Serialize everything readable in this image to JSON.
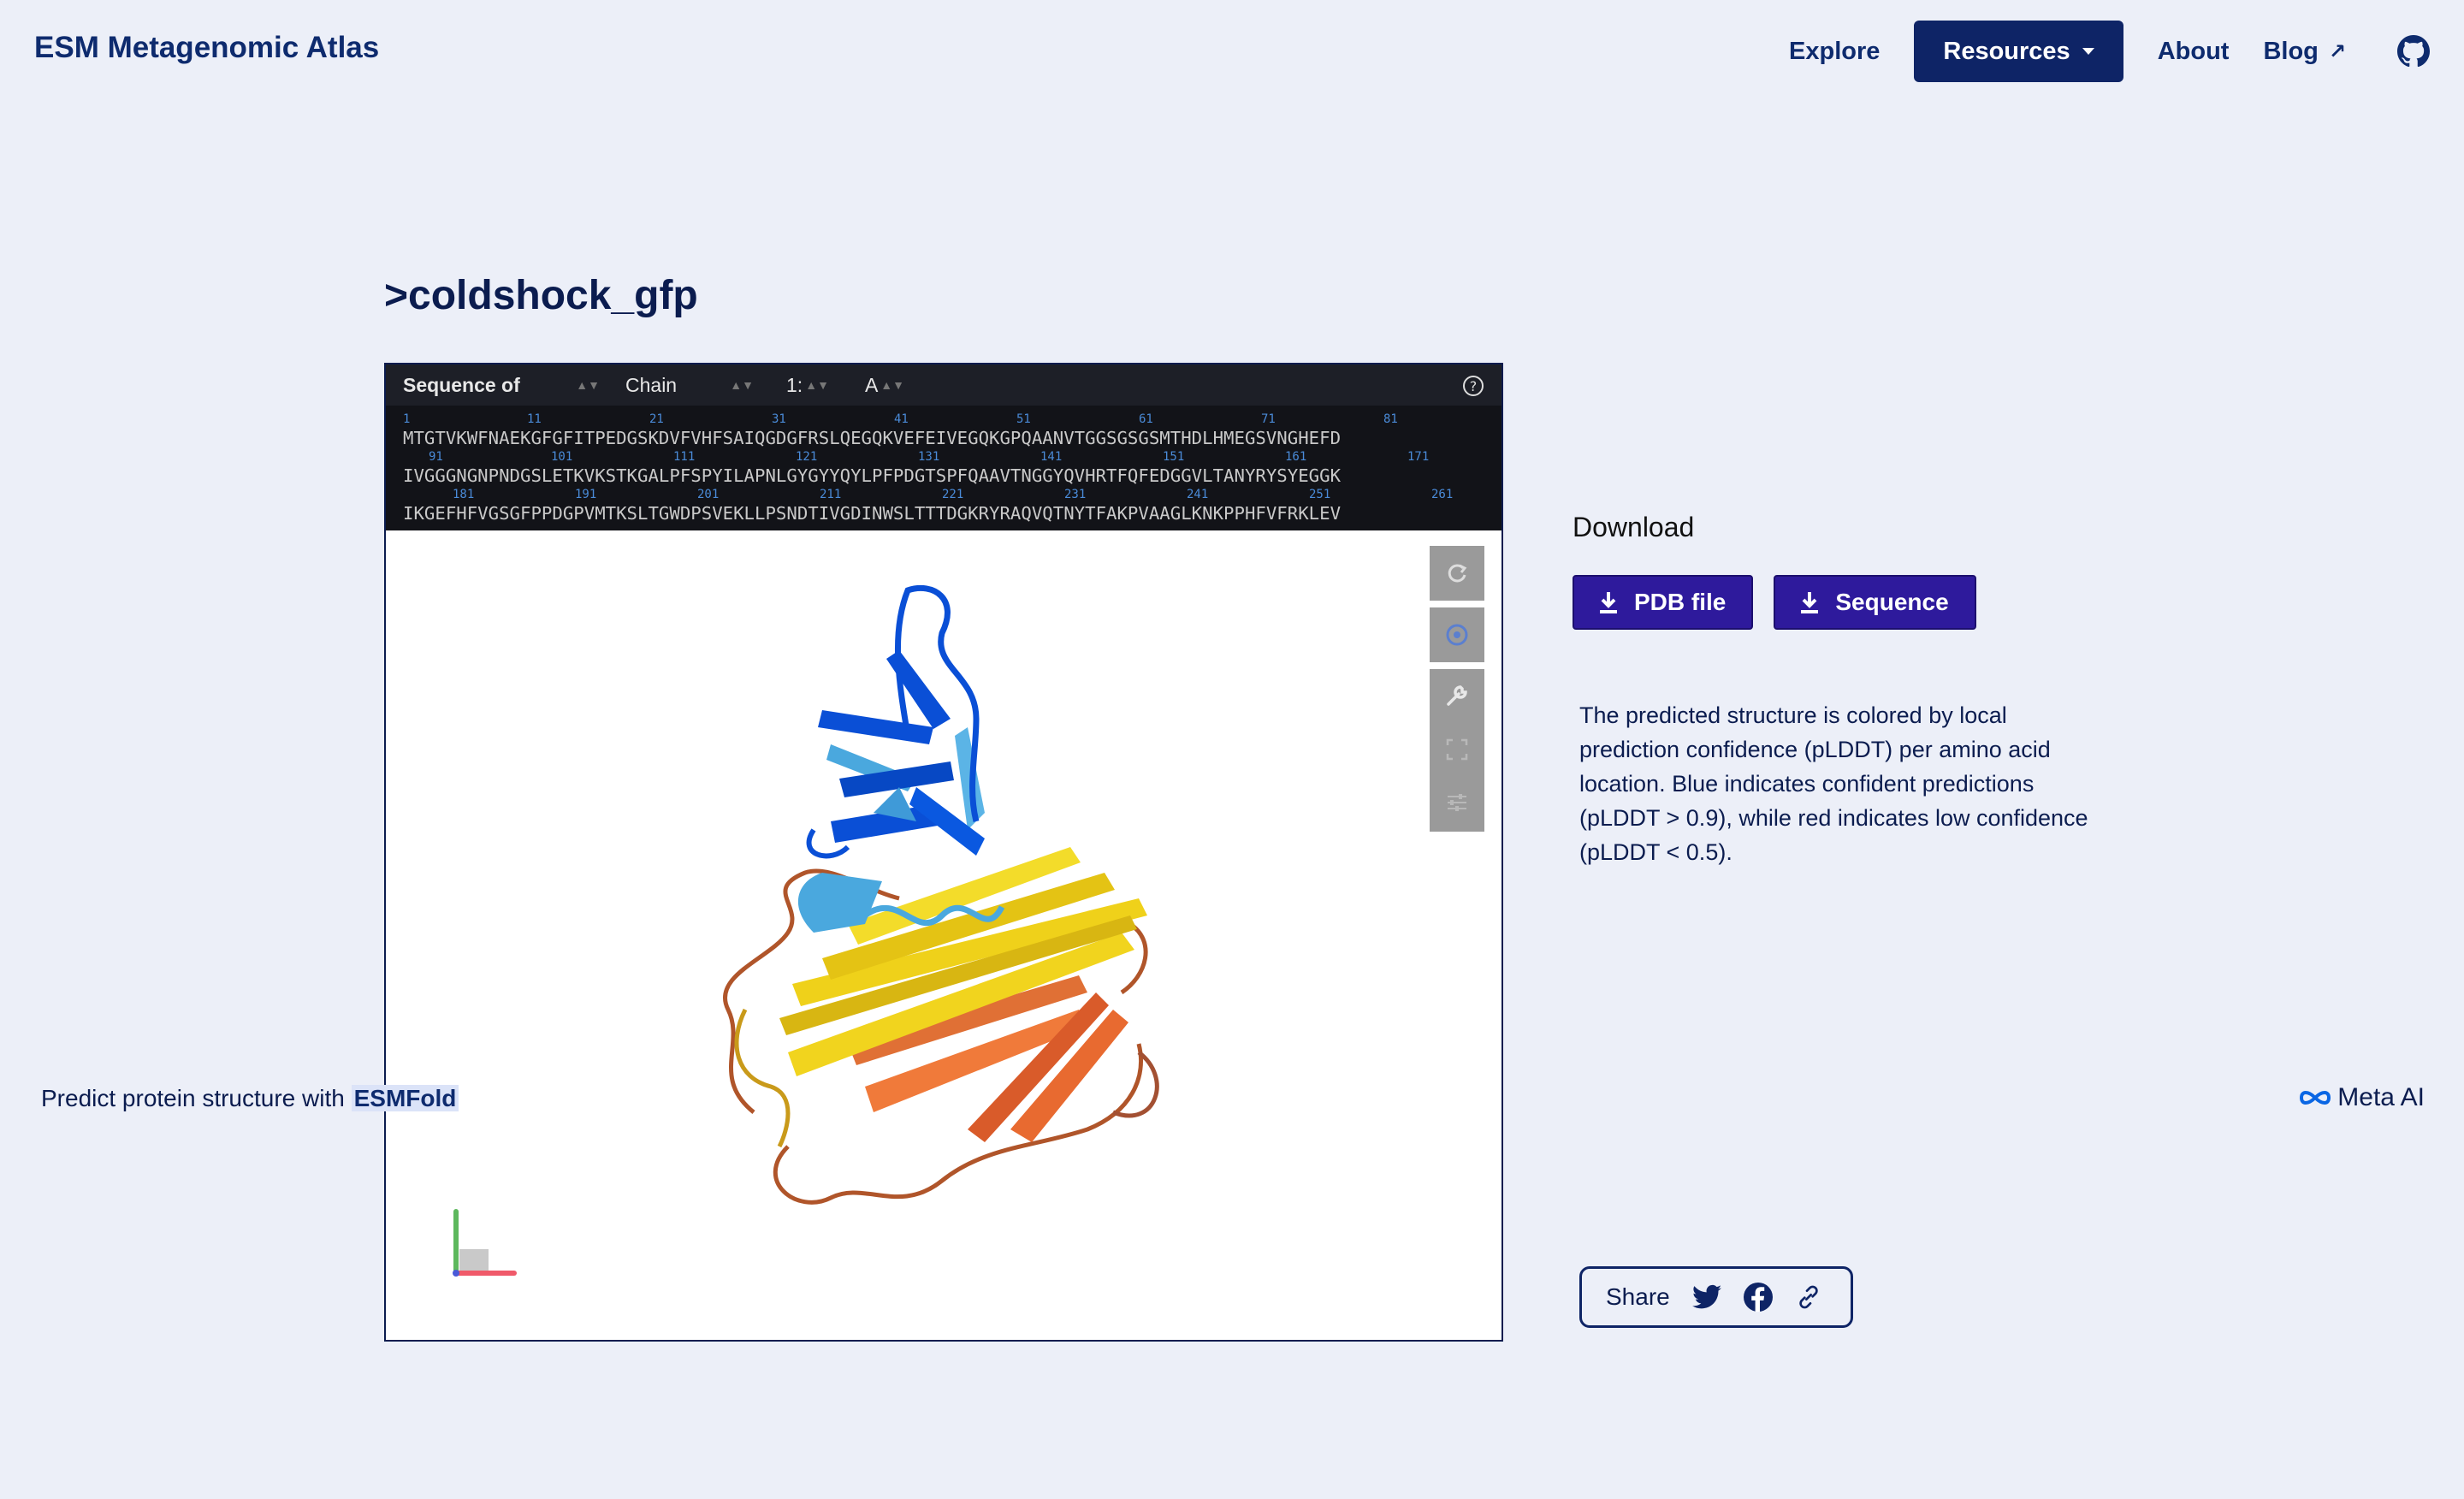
{
  "header": {
    "brand": "ESM Metagenomic Atlas",
    "nav": {
      "explore": "Explore",
      "resources": "Resources",
      "about": "About",
      "blog": "Blog",
      "blog_ext": "↗"
    }
  },
  "page_title": ">coldshock_gfp",
  "viewer": {
    "controls": {
      "sequence_of": "Sequence of",
      "chain": "Chain",
      "index": "1:",
      "chain_id": "A"
    },
    "sequence_rows": [
      {
        "numbers": [
          "1",
          "11",
          "21",
          "31",
          "41",
          "51",
          "61",
          "71",
          "81"
        ],
        "text": "MTGTVKWFNAEKGFGFITPEDGSKDVFVHFSAIQGDGFRSLQEGQKVEFEIVEGQKGPQAANVTGGSGSGSMTHDLHMEGSVNGHEFD"
      },
      {
        "numbers": [
          "91",
          "101",
          "111",
          "121",
          "131",
          "141",
          "151",
          "161",
          "171"
        ],
        "text": "IVGGGNGNPNDGSLETKVKSTKGALPFSPYILAPNLGYGYYQYLPFPDGTSPFQAAVTNGGYQVHRTFQFEDGGVLTANYRYSYEGGK"
      },
      {
        "numbers": [
          "181",
          "191",
          "201",
          "211",
          "221",
          "231",
          "241",
          "251",
          "261"
        ],
        "text": "IKGEFHFVGSGFPPDGPVMTKSLTGWDPSVEKLLPSNDTIVGDINWSLTTTDGKRYRAQVQTNYTFAKPVAAGLKNKPPHFVFRKLEV"
      }
    ]
  },
  "download": {
    "title": "Download",
    "pdb_label": "PDB file",
    "sequence_label": "Sequence"
  },
  "description": "The predicted structure is colored by local prediction confidence (pLDDT) per amino acid location. Blue indicates confident predictions (pLDDT > 0.9), while red indicates low confidence (pLDDT < 0.5).",
  "share": {
    "label": "Share"
  },
  "footer": {
    "predict_text": "Predict protein structure with",
    "predict_link": "ESMFold",
    "meta_label": "Meta AI"
  },
  "colors": {
    "navy": "#0e2466",
    "purple_button": "#2e1a9c",
    "background": "#eceff8",
    "confident_blue": "#0a4fd6",
    "low_orange": "#f07a3a",
    "mid_yellow": "#efd11a"
  }
}
